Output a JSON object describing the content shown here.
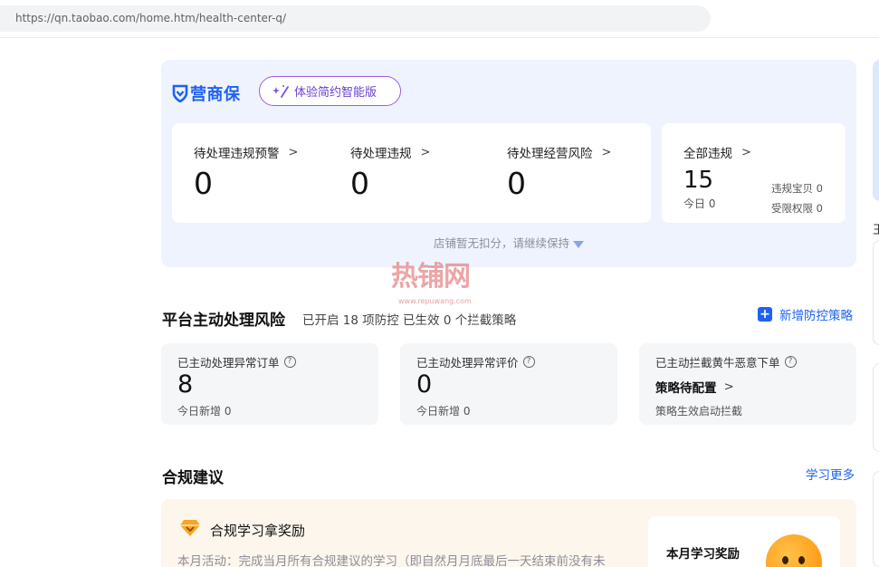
{
  "browser": {
    "url": "https://qn.taobao.com/home.htm/health-center-q/"
  },
  "header": {
    "logo_text": "营商保",
    "trial_button": "体验简约智能版",
    "stats": [
      {
        "label": "待处理违规预警",
        "value": "0"
      },
      {
        "label": "待处理违规",
        "value": "0"
      },
      {
        "label": "待处理经营风险",
        "value": "0"
      }
    ],
    "all_violations": {
      "label": "全部违规",
      "value": "15",
      "today": "今日 0",
      "items": [
        "违规宝贝 0",
        "受限权限 0"
      ]
    },
    "keep_message": "店铺暂无扣分，请继续保持"
  },
  "watermark": {
    "big": "热铺网",
    "small": "www.repuwang.com"
  },
  "platform_risk": {
    "title": "平台主动处理风险",
    "subtitle": "已开启 18 项防控 已生效 0 个拦截策略",
    "new_strategy": "新增防控策略",
    "cards": [
      {
        "label": "已主动处理异常订单",
        "value": "8",
        "foot": "今日新增 0"
      },
      {
        "label": "已主动处理异常评价",
        "value": "0",
        "foot": "今日新增 0"
      },
      {
        "label": "已主动拦截黄牛恶意下单",
        "pending": "策略待配置",
        "foot": "策略生效启动拦截"
      }
    ]
  },
  "compliance": {
    "title": "合规建议",
    "learn_more": "学习更多",
    "card_title": "合规学习拿奖励",
    "card_desc": "本月活动：完成当月所有合规建议的学习（即自然月月底最后一天结束前没有未",
    "reward_title": "本月学习奖励"
  },
  "right_edge": {
    "glyph": "王"
  },
  "colors": {
    "accent": "#1d62f2",
    "purple": "#6b3fd4",
    "header_bg": "#eff3fd"
  }
}
